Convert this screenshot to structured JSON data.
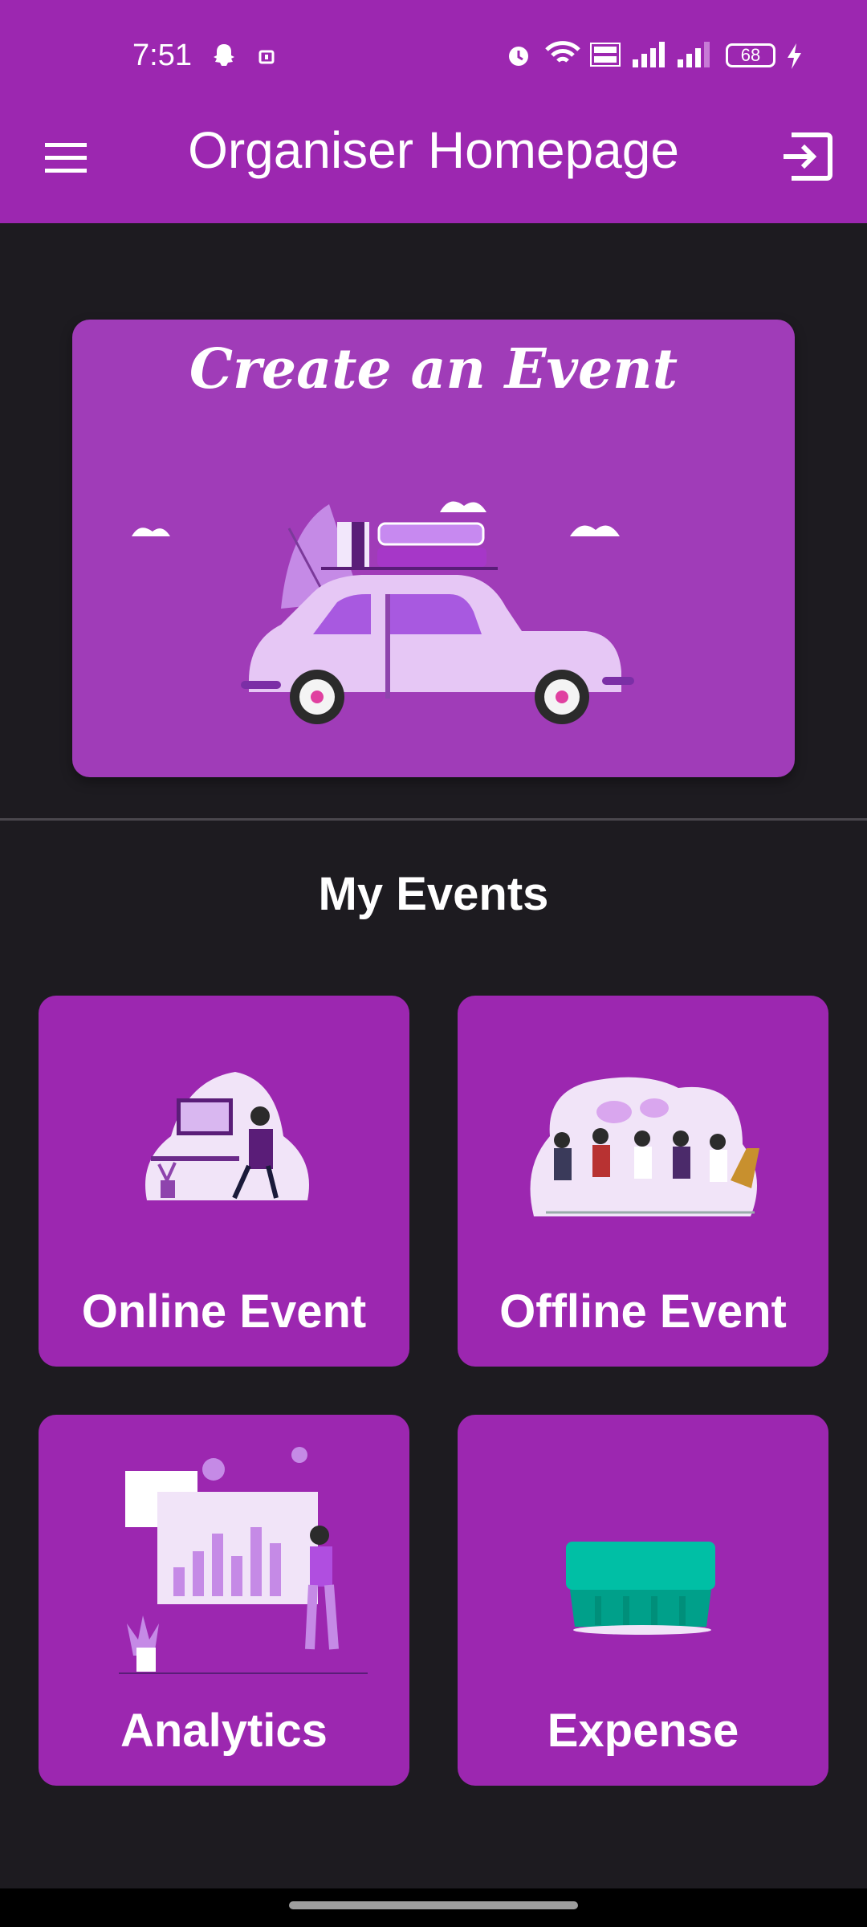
{
  "status_bar": {
    "time": "7:51",
    "battery": "68",
    "icons": [
      "snapchat-icon",
      "notification-icon",
      "alarm-icon",
      "wifi-icon",
      "volte-icon",
      "signal-icon",
      "signal-icon",
      "battery-icon",
      "charging-icon"
    ]
  },
  "app_bar": {
    "title": "Organiser Homepage",
    "menu_icon": "menu-icon",
    "logout_icon": "logout-icon"
  },
  "create_event": {
    "title": "Create an Event"
  },
  "my_events": {
    "title": "My Events",
    "tiles": [
      {
        "label": "Online Event"
      },
      {
        "label": "Offline Event"
      },
      {
        "label": "Analytics"
      },
      {
        "label": "Expense"
      }
    ]
  },
  "colors": {
    "primary": "#9c27b0",
    "card": "#a03cb8",
    "background": "#1d1b20"
  }
}
